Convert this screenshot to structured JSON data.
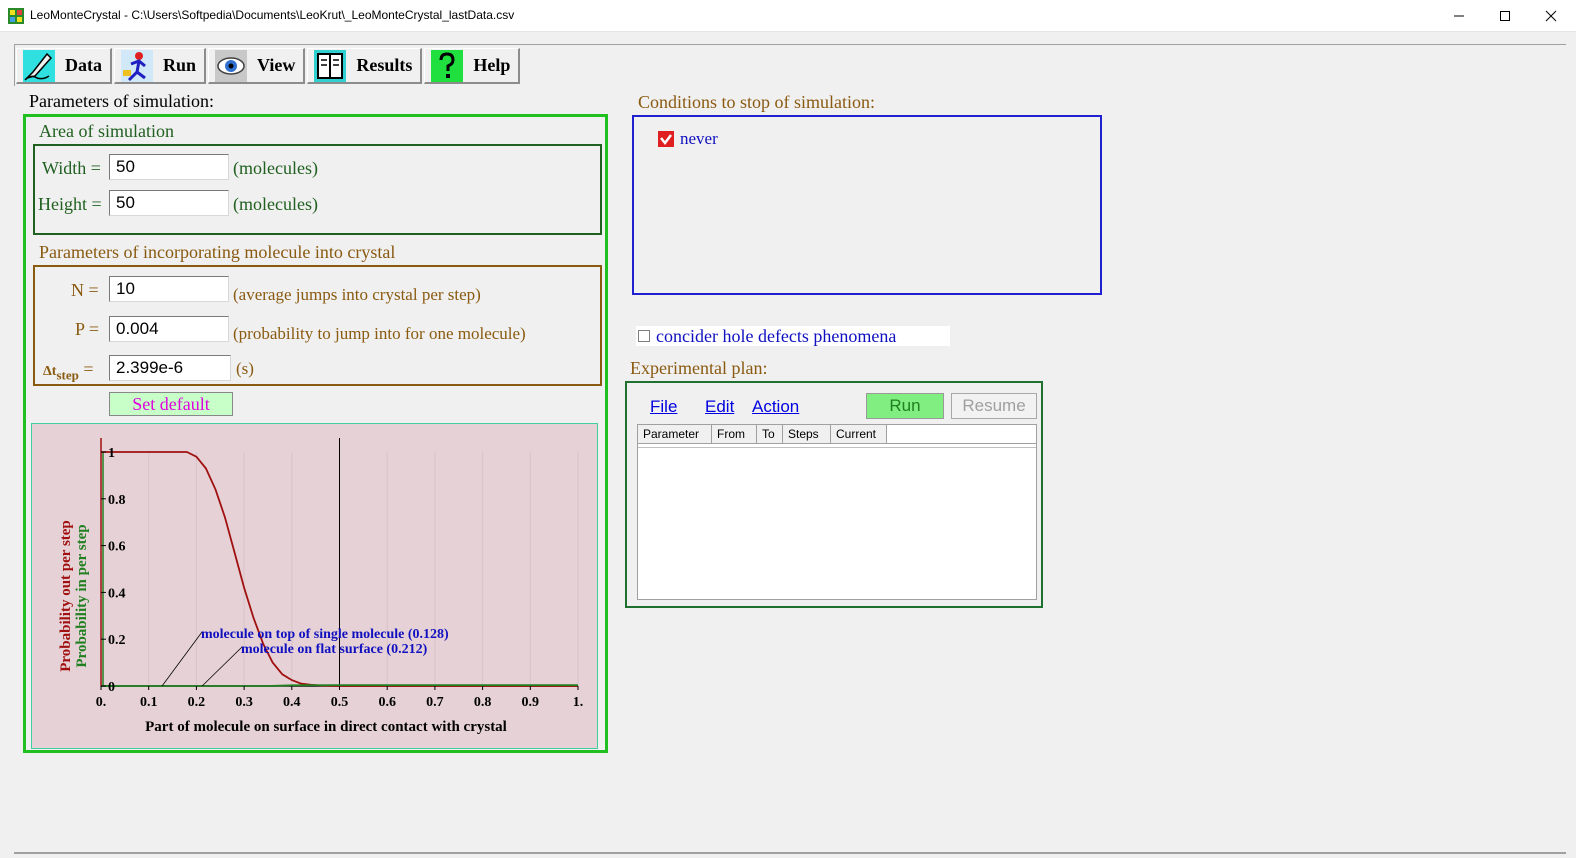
{
  "window": {
    "title": "LeoMonteCrystal - C:\\Users\\Softpedia\\Documents\\LeoKrut\\_LeoMonteCrystal_lastData.csv",
    "min_glyph": "—",
    "max_glyph": "☐",
    "close_glyph": "✕"
  },
  "toolbar": {
    "items": [
      {
        "label": "Data",
        "icon": "pen-writing-icon"
      },
      {
        "label": "Run",
        "icon": "running-figure-icon"
      },
      {
        "label": "View",
        "icon": "eye-icon"
      },
      {
        "label": "Results",
        "icon": "book-icon"
      },
      {
        "label": "Help",
        "icon": "question-mark-icon"
      }
    ]
  },
  "params": {
    "heading": "Parameters of simulation:",
    "area": {
      "title": "Area of simulation",
      "width_label": "Width =",
      "width_value": "50",
      "width_unit": "(molecules)",
      "height_label": "Height =",
      "height_value": "50",
      "height_unit": "(molecules)"
    },
    "incorp": {
      "title": "Parameters of incorporating molecule into crystal",
      "n_label": "N =",
      "n_value": "10",
      "n_unit": "(average jumps into crystal per step)",
      "p_label": "P =",
      "p_value": "0.004",
      "p_unit": "(probability to jump into for one molecule)",
      "dt_label_main": "Δt",
      "dt_label_sub": "step",
      "dt_label_eq": " =",
      "dt_value": "2.399e-6",
      "dt_unit": "(s)"
    },
    "set_default": "Set default"
  },
  "chart_data": {
    "type": "line",
    "xlabel": "Part of molecule on surface in direct contact with crystal",
    "ylabel_out": "Probability out per step",
    "ylabel_in": "Probability in per step",
    "xlim": [
      0,
      1
    ],
    "ylim": [
      0,
      1.0
    ],
    "x_ticks": [
      "0.",
      "0.1",
      "0.2",
      "0.3",
      "0.4",
      "0.5",
      "0.6",
      "0.7",
      "0.8",
      "0.9",
      "1."
    ],
    "y_ticks": [
      "0",
      "0.2",
      "0.4",
      "0.6",
      "0.8",
      "1"
    ],
    "colors": {
      "out": "#a01010",
      "in": "#208020",
      "annotation": "#1010c0",
      "marker": "#000000"
    },
    "vertical_marker_x": 0.5,
    "series": [
      {
        "key": "out",
        "x": [
          0,
          0.18,
          0.2,
          0.22,
          0.24,
          0.26,
          0.28,
          0.3,
          0.32,
          0.34,
          0.36,
          0.38,
          0.4,
          0.42,
          0.44,
          0.46,
          0.5,
          0.6,
          1.0
        ],
        "y": [
          1.0,
          1.0,
          0.98,
          0.93,
          0.84,
          0.72,
          0.57,
          0.42,
          0.29,
          0.18,
          0.1,
          0.05,
          0.025,
          0.01,
          0.005,
          0.002,
          0.0,
          0.0,
          0.0
        ]
      },
      {
        "key": "in",
        "x": [
          0,
          0.35,
          0.4,
          0.5,
          1.0
        ],
        "y": [
          0.0,
          0.0,
          0.003,
          0.004,
          0.004
        ]
      }
    ],
    "annotations": [
      {
        "text": "molecule on top of single molecule (0.128)",
        "x": 0.128
      },
      {
        "text": "molecule on flat surface (0.212)",
        "x": 0.212
      }
    ]
  },
  "stop": {
    "heading": "Conditions to stop of simulation:",
    "never_label": "never"
  },
  "hole": {
    "label": "concider hole defects phenomena"
  },
  "plan": {
    "heading": "Experimental plan:",
    "menu": {
      "file": "File",
      "edit": "Edit",
      "action": "Action"
    },
    "run_label": "Run",
    "resume_label": "Resume",
    "columns": [
      "Parameter",
      "From",
      "To",
      "Steps",
      "Current"
    ]
  }
}
